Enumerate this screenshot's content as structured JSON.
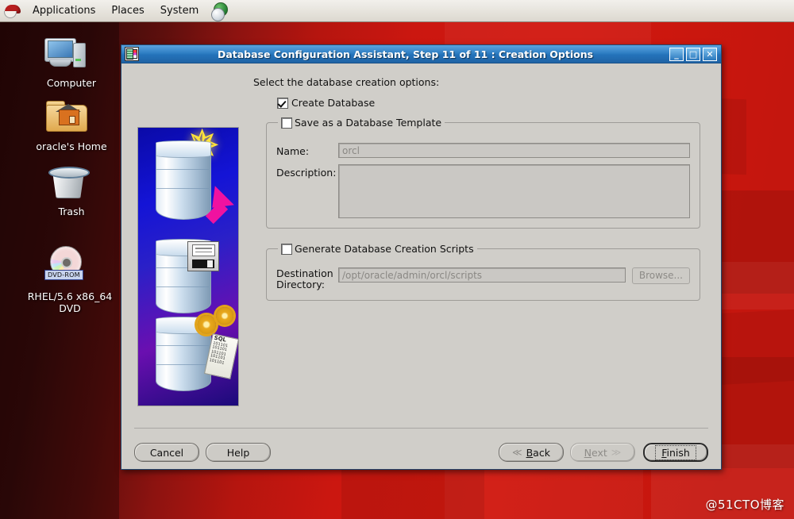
{
  "panel": {
    "logo_icon": "redhat-logo-icon",
    "menus": [
      {
        "label": "Applications"
      },
      {
        "label": "Places"
      },
      {
        "label": "System"
      }
    ],
    "browser_icon": "globe-browser-icon"
  },
  "desktop": {
    "icons": [
      {
        "label": "Computer",
        "icon": "computer-icon"
      },
      {
        "label": "oracle's Home",
        "icon": "home-folder-icon"
      },
      {
        "label": "Trash",
        "icon": "trash-icon"
      },
      {
        "label": "RHEL/5.6 x86_64 DVD",
        "icon": "dvd-rom-icon",
        "badge": "DVD-ROM"
      }
    ],
    "watermark": "@51CTO博客",
    "wallpaper_color": "#c4160e"
  },
  "dialog": {
    "title": "Database Configuration Assistant, Step 11 of 11 : Creation Options",
    "window_icon": "database-assistant-icon",
    "titlebar_color": "#2f7fc4",
    "controls": {
      "minimize": "_",
      "maximize": "□",
      "close": "✕"
    },
    "banner": {
      "icon": "oracle-database-banner-image",
      "scroll_label": "SQL",
      "scroll_lines": "101101 101101 101101 101101 101101"
    },
    "lead_text": "Select the database creation options:",
    "create_database": {
      "label": "Create Database",
      "checked": true
    },
    "template_group": {
      "legend": "Save as a Database Template",
      "checked": false,
      "name_label": "Name:",
      "name_value": "orcl",
      "description_label": "Description:",
      "description_value": ""
    },
    "scripts_group": {
      "legend": "Generate Database Creation Scripts",
      "checked": false,
      "destination_label_line1": "Destination",
      "destination_label_line2": "Directory:",
      "destination_value": "/opt/oracle/admin/orcl/scripts",
      "browse_label": "Browse...",
      "browse_enabled": false
    },
    "buttons": {
      "cancel": "Cancel",
      "help": "Help",
      "back": "Back",
      "back_mnemonic": "B",
      "next": "Next",
      "next_mnemonic": "N",
      "next_enabled": false,
      "finish": "Finish",
      "finish_mnemonic": "F",
      "finish_focused": true,
      "back_chevron": "≪",
      "next_chevron": "≫"
    }
  }
}
